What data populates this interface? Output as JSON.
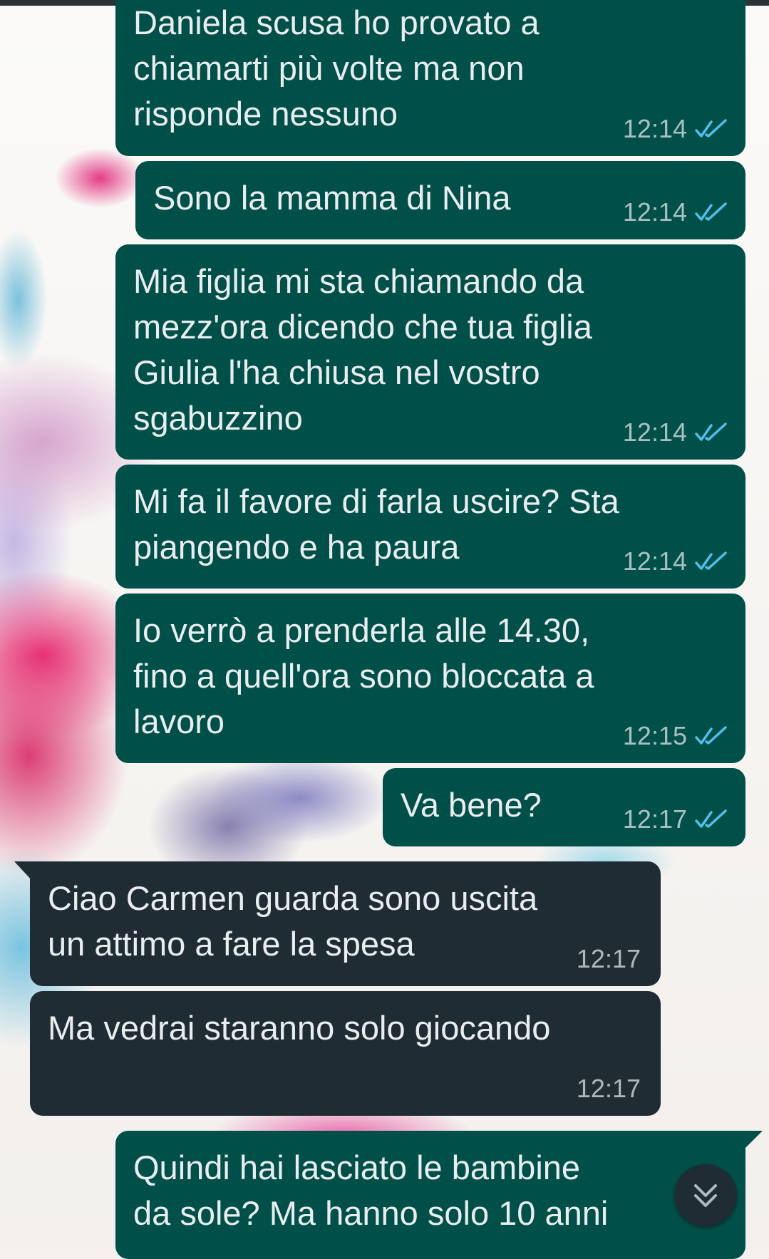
{
  "chat": {
    "messages": [
      {
        "direction": "outgoing",
        "text": "Daniela scusa ho provato a\nchiamarti più volte ma non\nrisponde nessuno",
        "time": "12:14",
        "status": "read"
      },
      {
        "direction": "outgoing",
        "text": "Sono la mamma di Nina",
        "time": "12:14",
        "status": "read"
      },
      {
        "direction": "outgoing",
        "text": "Mia figlia mi sta chiamando da\nmezz'ora dicendo che tua figlia\nGiulia l'ha chiusa nel vostro\nsgabuzzino",
        "time": "12:14",
        "status": "read"
      },
      {
        "direction": "outgoing",
        "text": "Mi fa il favore di farla uscire? Sta\npiangendo e ha paura",
        "time": "12:14",
        "status": "read"
      },
      {
        "direction": "outgoing",
        "text": "Io verrò a prenderla alle 14.30,\nfino a quell'ora sono bloccata a\nlavoro",
        "time": "12:15",
        "status": "read"
      },
      {
        "direction": "outgoing",
        "text": "Va bene?",
        "time": "12:17",
        "status": "read"
      },
      {
        "direction": "incoming",
        "text": "Ciao Carmen guarda sono uscita\nun attimo a fare la spesa",
        "time": "12:17"
      },
      {
        "direction": "incoming",
        "text": "Ma vedrai staranno solo giocando",
        "time": "12:17"
      },
      {
        "direction": "outgoing",
        "text": "Quindi hai lasciato le bambine\nda sole? Ma hanno solo 10 anni",
        "time": "",
        "status": ""
      }
    ]
  },
  "icons": {
    "read_receipt": "double-check-icon",
    "scroll_down": "double-chevron-down-icon"
  },
  "colors": {
    "outgoing_bubble": "#005049",
    "incoming_bubble": "#1f2c34",
    "read_tick": "#53bdeb",
    "message_text": "#e9edef"
  }
}
